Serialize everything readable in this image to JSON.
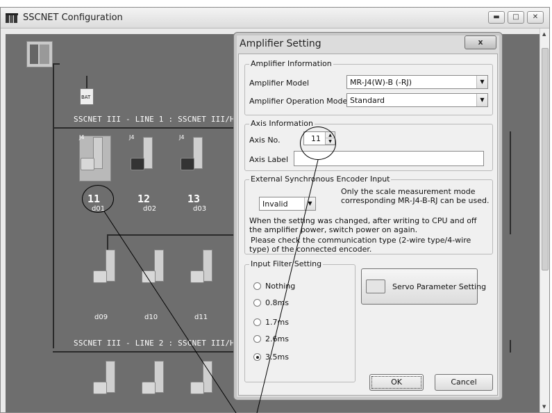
{
  "window": {
    "title": "SSCNET Configuration",
    "minimize_icon": "minimize-icon",
    "maximize_icon": "maximize-icon",
    "close_icon": "close-icon"
  },
  "diagram": {
    "battery_label": "BAT",
    "line1_label": "SSCNET III - LINE 1 : SSCNET III/H",
    "line2_label": "SSCNET III - LINE 2 : SSCNET III/H",
    "top_amps": [
      {
        "tag": "J4",
        "axis": "11",
        "name": "d01"
      },
      {
        "tag": "J4",
        "axis": "12",
        "name": "d02"
      },
      {
        "tag": "J4",
        "axis": "13",
        "name": "d03"
      }
    ],
    "mid_amps": [
      {
        "name": "d09"
      },
      {
        "name": "d10"
      },
      {
        "name": "d11"
      }
    ]
  },
  "dialog": {
    "title": "Amplifier Setting",
    "close_label": "x",
    "amp_info": {
      "legend": "Amplifier Information",
      "model_label": "Amplifier Model",
      "model_value": "MR-J4(W)-B (-RJ)",
      "mode_label": "Amplifier Operation Mode",
      "mode_value": "Standard"
    },
    "axis_info": {
      "legend": "Axis Information",
      "axis_no_label": "Axis No.",
      "axis_no_value": "11",
      "axis_label_label": "Axis Label",
      "axis_label_value": ""
    },
    "ext_encoder": {
      "legend": "External Synchronous Encoder Input",
      "value": "Invalid",
      "note1": "Only the scale measurement mode corresponding MR-J4-B-RJ can be used.",
      "note2": "When the setting was changed, after writing to CPU and off the amplifier power, switch power on again.",
      "note3": "Please check the communication type (2-wire type/4-wire type) of the connected encoder."
    },
    "input_filter": {
      "legend": "Input Filter Setting",
      "options": [
        "Nothing",
        "0.8ms",
        "1.7ms",
        "2.6ms",
        "3.5ms"
      ],
      "selected_index": 4
    },
    "servo_param_button": "Servo Parameter Setting",
    "ok_button": "OK",
    "cancel_button": "Cancel"
  }
}
